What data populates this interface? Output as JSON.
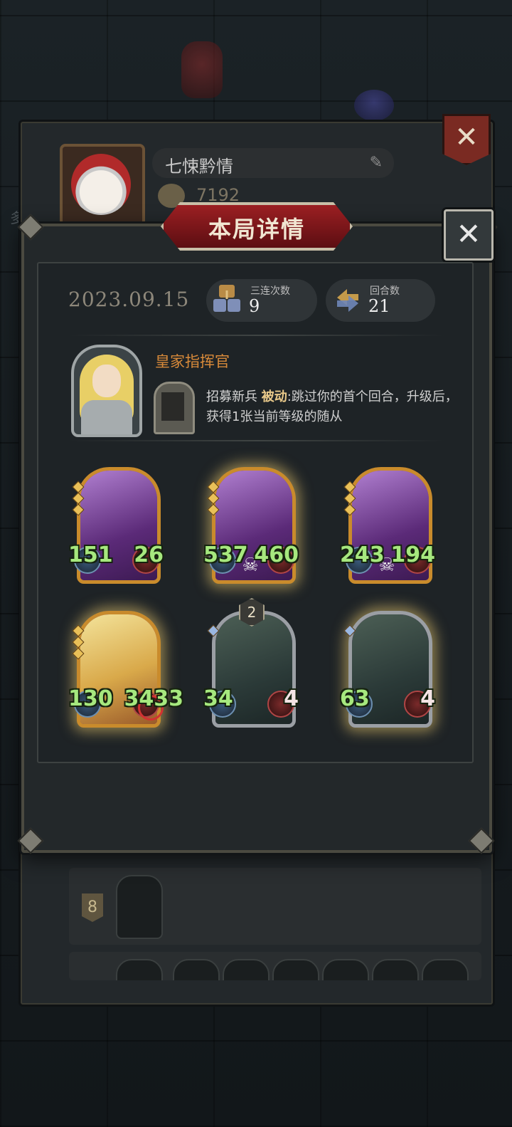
{
  "profile": {
    "player_name": "七悚黔情",
    "coins": "7192"
  },
  "background": {
    "side_char": "多",
    "rank_badge": "8"
  },
  "modal": {
    "title": "本局详情",
    "close_icon": "✕",
    "date": "2023.09.15",
    "triple_label": "三连次数",
    "triple_value": "9",
    "rounds_label": "回合数",
    "rounds_value": "21"
  },
  "hero": {
    "name": "皇家指挥官",
    "skill_name": "招募新兵",
    "skill_type": "被动",
    "skill_desc": ":跳过你的首个回合，升级后，获得1张当前等级的随从"
  },
  "units": [
    {
      "attack": "151",
      "health": "26",
      "frame": "gold",
      "art": "purple",
      "glow": false
    },
    {
      "attack": "537",
      "health": "460",
      "frame": "gold",
      "art": "purple",
      "glow": true,
      "skull": true
    },
    {
      "attack": "243",
      "health": "194",
      "frame": "gold",
      "art": "purple",
      "glow": false,
      "skull": true
    },
    {
      "attack": "130",
      "health": "3433",
      "frame": "gold",
      "art": "yellow",
      "glow": true,
      "target": true
    },
    {
      "attack": "34",
      "health": "4",
      "frame": "silver",
      "art": "dark",
      "glow": false,
      "level": "2"
    },
    {
      "attack": "63",
      "health": "4",
      "frame": "silver",
      "art": "dark",
      "glow": true
    }
  ],
  "colors": {
    "stat_green": "#a6e87e",
    "hero_name_orange": "#d88a3a",
    "banner_red": "#9b1f22"
  }
}
